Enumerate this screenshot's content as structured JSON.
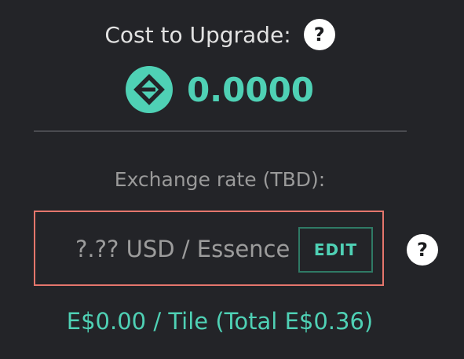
{
  "cost": {
    "label": "Cost to Upgrade:",
    "help_glyph": "?",
    "currency_icon": "essence-icon",
    "amount": "0.0000"
  },
  "exchange": {
    "label": "Exchange rate (TBD):",
    "rate_text": "?.?? USD / Essence",
    "edit_label": "EDIT",
    "help_glyph": "?"
  },
  "total": {
    "text": "E$0.00 / Tile (Total E$0.36)"
  },
  "colors": {
    "background": "#232428",
    "accent": "#4fd1b5",
    "box_border": "#e4766c",
    "edit_border": "#2f7a65"
  }
}
